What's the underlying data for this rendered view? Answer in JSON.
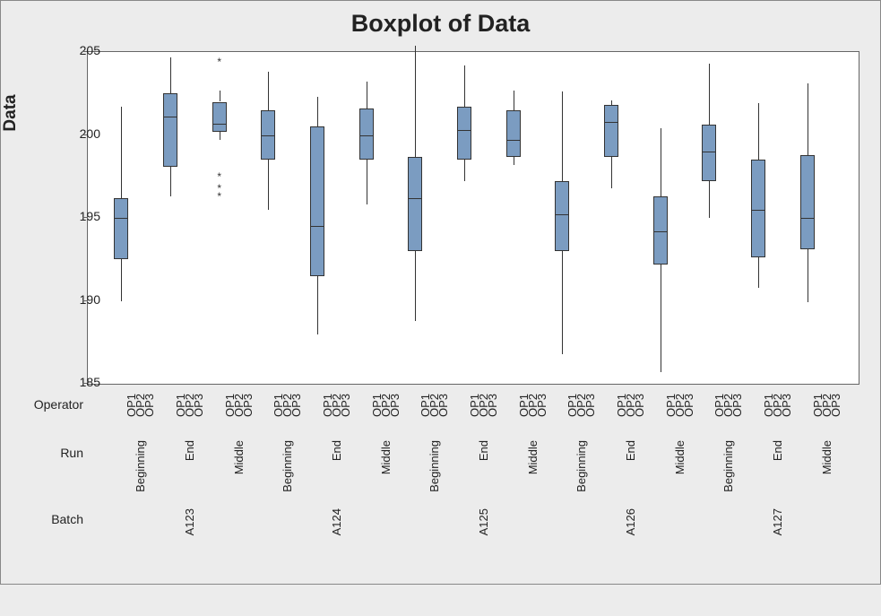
{
  "chart_data": {
    "type": "box",
    "title": "Boxplot of Data",
    "ylabel": "Data",
    "ylim": [
      185,
      205
    ],
    "yticks": [
      185,
      190,
      195,
      200,
      205
    ],
    "row_labels": [
      "Operator",
      "Run",
      "Batch"
    ],
    "batches": [
      "A123",
      "A124",
      "A125",
      "A126",
      "A127"
    ],
    "runs": [
      "Beginning",
      "End",
      "Middle"
    ],
    "operators": [
      "OP1",
      "OP2",
      "OP3"
    ],
    "series": [
      {
        "key": "A123-Beg",
        "op1": {
          "q1": 192.5,
          "med": 195.0,
          "q3": 196.2,
          "lo": 190.0,
          "hi": 201.7
        }
      },
      {
        "key": "A123-End",
        "op1": {
          "q1": 198.1,
          "med": 201.1,
          "q3": 202.5,
          "lo": 196.3,
          "hi": 204.7
        }
      },
      {
        "key": "A123-Mid",
        "op1": {
          "q1": 200.2,
          "med": 200.7,
          "q3": 202.0,
          "lo": 199.7,
          "hi": 202.7
        },
        "op1_outliers": [
          204.4,
          197.5,
          196.8,
          196.3
        ]
      },
      {
        "key": "A124-Beg",
        "op1": {
          "q1": 198.5,
          "med": 200.0,
          "q3": 201.5,
          "lo": 195.5,
          "hi": 203.8
        }
      },
      {
        "key": "A124-End",
        "op1": {
          "q1": 191.5,
          "med": 194.5,
          "q3": 200.5,
          "lo": 188.0,
          "hi": 202.3
        }
      },
      {
        "key": "A124-Mid",
        "op1": {
          "q1": 198.5,
          "med": 200.0,
          "q3": 201.6,
          "lo": 195.8,
          "hi": 203.2
        }
      },
      {
        "key": "A125-Beg",
        "op1": {
          "q1": 193.0,
          "med": 196.2,
          "q3": 198.7,
          "lo": 188.8,
          "hi": 205.4
        }
      },
      {
        "key": "A125-End",
        "op1": {
          "q1": 198.5,
          "med": 200.3,
          "q3": 201.7,
          "lo": 197.2,
          "hi": 204.2
        }
      },
      {
        "key": "A125-Mid",
        "op1": {
          "q1": 198.7,
          "med": 199.7,
          "q3": 201.5,
          "lo": 198.2,
          "hi": 202.7
        }
      },
      {
        "key": "A126-Beg",
        "op1": {
          "q1": 193.0,
          "med": 195.2,
          "q3": 197.2,
          "lo": 186.8,
          "hi": 202.6
        }
      },
      {
        "key": "A126-End",
        "op1": {
          "q1": 198.7,
          "med": 200.8,
          "q3": 201.8,
          "lo": 196.8,
          "hi": 202.1
        }
      },
      {
        "key": "A126-Mid",
        "op1": {
          "q1": 192.2,
          "med": 194.2,
          "q3": 196.3,
          "lo": 185.7,
          "hi": 200.4
        }
      },
      {
        "key": "A127-Beg",
        "op1": {
          "q1": 197.2,
          "med": 199.0,
          "q3": 200.6,
          "lo": 195.0,
          "hi": 204.3
        }
      },
      {
        "key": "A127-End",
        "op1": {
          "q1": 192.6,
          "med": 195.5,
          "q3": 198.5,
          "lo": 190.8,
          "hi": 201.9
        }
      },
      {
        "key": "A127-Mid",
        "op1": {
          "q1": 193.1,
          "med": 195.0,
          "q3": 198.8,
          "lo": 189.9,
          "hi": 203.1
        }
      }
    ]
  }
}
